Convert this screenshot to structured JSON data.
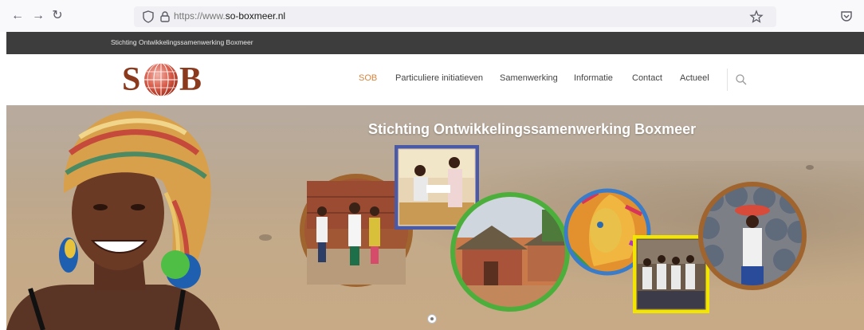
{
  "browser": {
    "url_prefix": "https://www.",
    "url_domain": "so-boxmeer.nl",
    "back_icon": "arrow-left-icon",
    "forward_icon": "arrow-right-icon",
    "reload_icon": "reload-icon"
  },
  "top_strip": {
    "text": "Stichting Ontwikkelingssamenwerking Boxmeer"
  },
  "logo": {
    "left": "S",
    "right": "B"
  },
  "menu": {
    "items": [
      {
        "label": "SOB",
        "active": true
      },
      {
        "label": "Particuliere initiatieven",
        "active": false
      },
      {
        "label": "Samenwerking",
        "active": false
      },
      {
        "label": "Informatie",
        "active": false
      },
      {
        "label": "Contact",
        "active": false
      },
      {
        "label": "Actueel",
        "active": false
      }
    ]
  },
  "hero": {
    "title": "Stichting Ontwikkelingssamenwerking Boxmeer"
  },
  "colors": {
    "accent": "#d9843b",
    "brand": "#8b3a1e",
    "frame_brown": "#a0642f",
    "frame_blue": "#4b5aa6",
    "frame_green": "#4caf3c",
    "frame_yellow": "#f2e600"
  }
}
